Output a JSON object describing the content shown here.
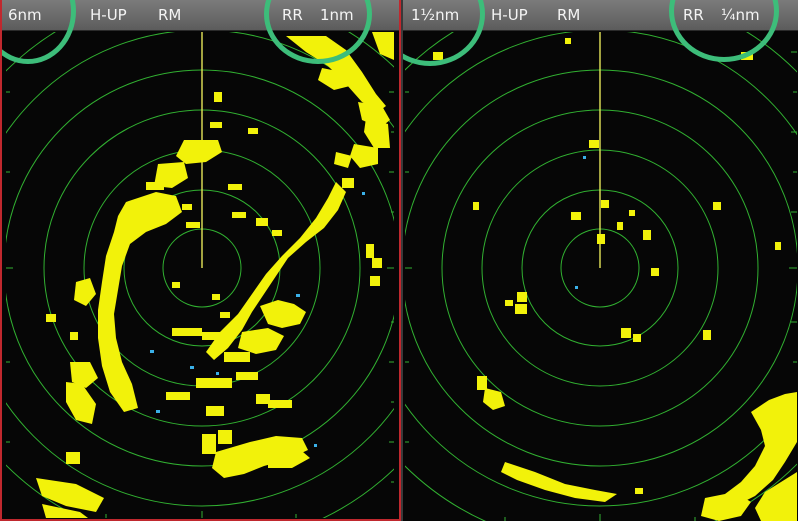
{
  "colors": {
    "header_bg": "#6b6b6b",
    "active_border": "#c0282e",
    "range_rings": "#31b031",
    "echo": "#f2f20a",
    "target": "#3ab0e8",
    "highlight_circle": "#3dbd7a",
    "heading_line": "#e6e65a"
  },
  "left_pane": {
    "range": "6nm",
    "orientation": "H-UP",
    "motion": "RM",
    "range_ring_label": "RR",
    "range_ring_value": "1nm",
    "active": true
  },
  "right_pane": {
    "range": "1½nm",
    "orientation": "H-UP",
    "motion": "RM",
    "range_ring_label": "RR",
    "range_ring_value": "¼nm",
    "active": false
  },
  "icons": {
    "heading_line": "heading-line-icon",
    "range_rings": "range-rings-icon",
    "bearing_scale": "bearing-scale-icon"
  }
}
